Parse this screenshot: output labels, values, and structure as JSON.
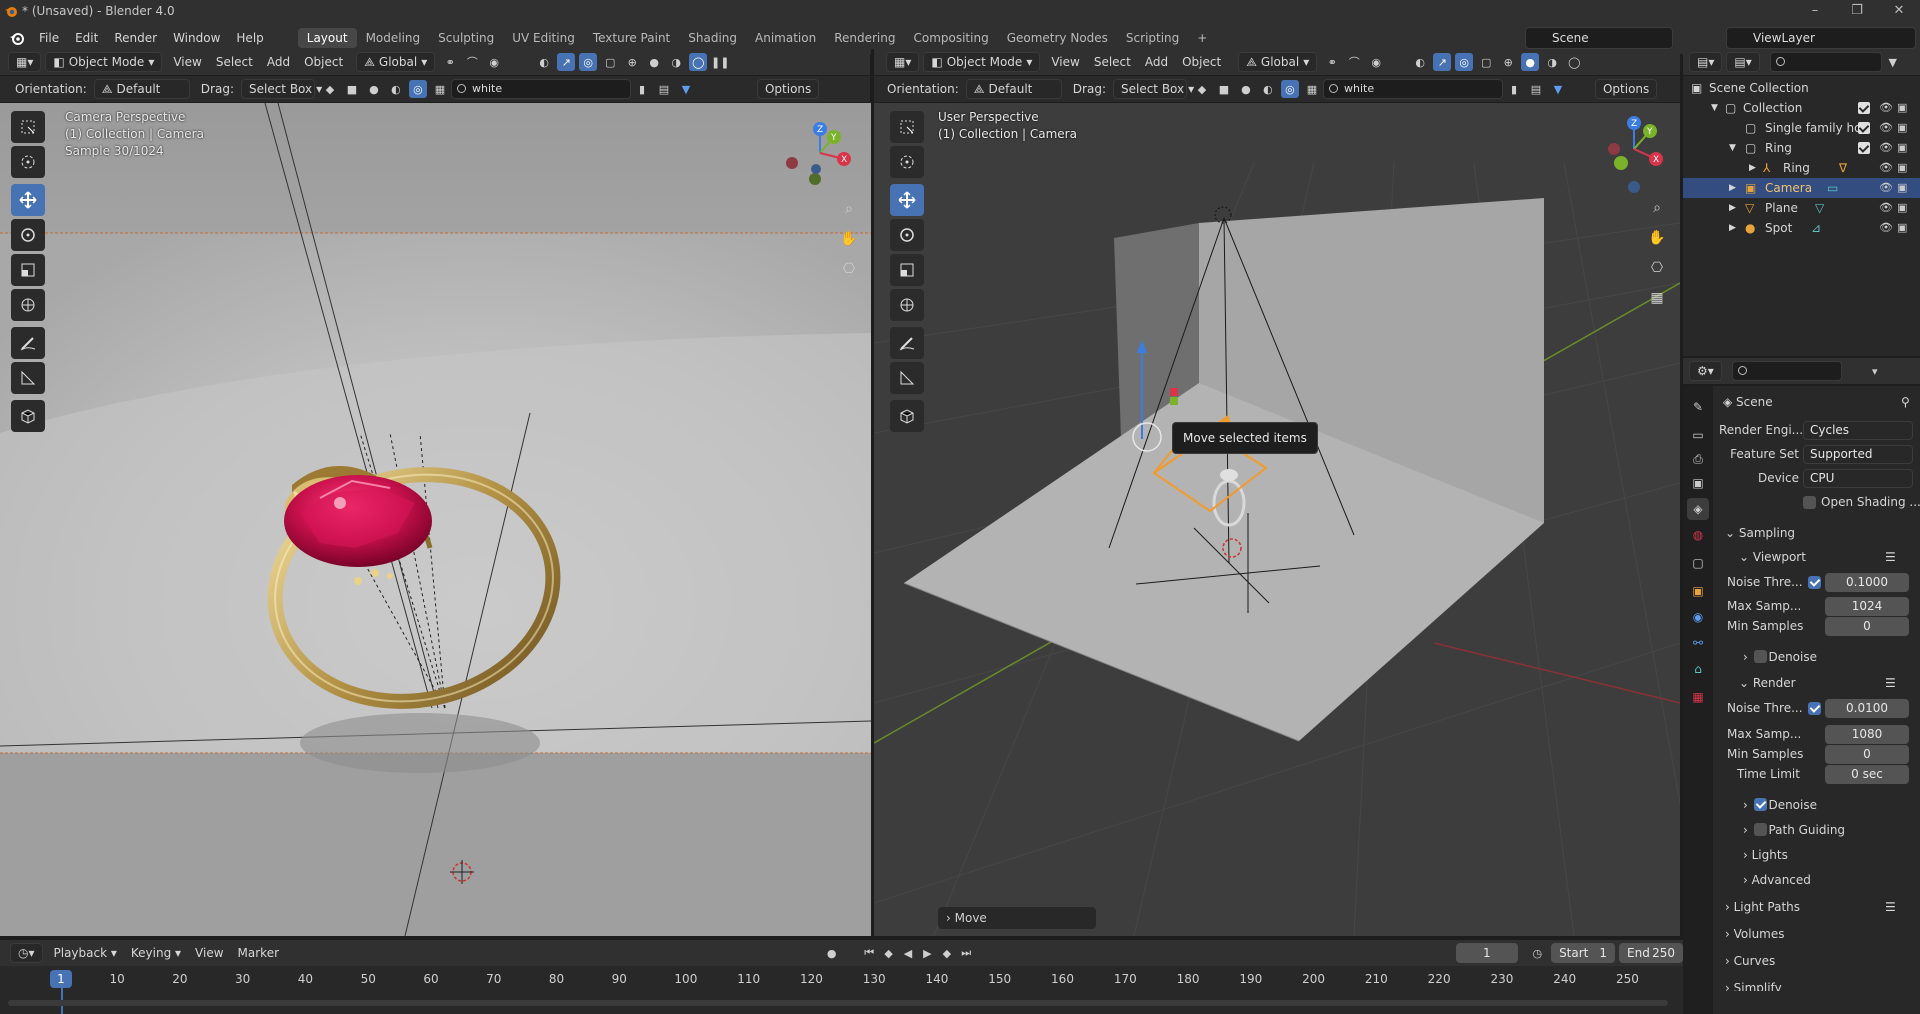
{
  "window": {
    "title": "* (Unsaved) - Blender 4.0",
    "minimize": "–",
    "maximize": "❐",
    "close": "✕"
  },
  "menu": [
    "File",
    "Edit",
    "Render",
    "Window",
    "Help"
  ],
  "workspaces": [
    "Layout",
    "Modeling",
    "Sculpting",
    "UV Editing",
    "Texture Paint",
    "Shading",
    "Animation",
    "Rendering",
    "Compositing",
    "Geometry Nodes",
    "Scripting",
    "+"
  ],
  "scene": "Scene",
  "view_layer": "ViewLayer",
  "left_view": {
    "mode": "Object Mode",
    "menus": [
      "View",
      "Select",
      "Add",
      "Object"
    ],
    "transform": "Global",
    "orientation_label": "Orientation:",
    "orientation": "Default",
    "drag_label": "Drag:",
    "drag": "Select Box",
    "search_value": "white",
    "options": "Options",
    "overlay": [
      "Camera Perspective",
      "(1) Collection | Camera",
      "Sample 30/1024"
    ]
  },
  "right_view": {
    "mode": "Object Mode",
    "menus": [
      "View",
      "Select",
      "Add",
      "Object"
    ],
    "transform": "Global",
    "orientation_label": "Orientation:",
    "orientation": "Default",
    "drag_label": "Drag:",
    "drag": "Select Box",
    "search_value": "white",
    "options": "Options",
    "overlay": [
      "User Perspective",
      "(1) Collection | Camera"
    ],
    "tooltip": "Move selected items",
    "last_op": "Move"
  },
  "outliner": {
    "rows": [
      {
        "label": "Scene Collection"
      },
      {
        "label": "Collection"
      },
      {
        "label": "Single family ho"
      },
      {
        "label": "Ring"
      },
      {
        "label": "Ring"
      },
      {
        "label": "Camera"
      },
      {
        "label": "Plane"
      },
      {
        "label": "Spot"
      }
    ]
  },
  "props": {
    "context": "Scene",
    "render_engine_label": "Render Engi...",
    "render_engine": "Cycles",
    "feature_set_label": "Feature Set",
    "feature_set": "Supported",
    "device_label": "Device",
    "device": "CPU",
    "osl_label": "Open Shading ...",
    "sampling": "Sampling",
    "viewport": "Viewport",
    "vp_noise_label": "Noise Thre...",
    "vp_noise": "0.1000",
    "vp_max_label": "Max Samp...",
    "vp_max": "1024",
    "vp_min_label": "Min Samples",
    "vp_min": "0",
    "denoise": "Denoise",
    "render": "Render",
    "r_noise_label": "Noise Thre...",
    "r_noise": "0.0100",
    "r_max_label": "Max Samp...",
    "r_max": "1080",
    "r_min_label": "Min Samples",
    "r_min": "0",
    "time_limit_label": "Time Limit",
    "time_limit": "0 sec",
    "r_denoise": "Denoise",
    "path_guiding": "Path Guiding",
    "lights": "Lights",
    "advanced": "Advanced",
    "light_paths": "Light Paths",
    "volumes": "Volumes",
    "curves": "Curves",
    "simplify": "Simplify"
  },
  "timeline": {
    "menus": [
      "Playback",
      "Keying",
      "View",
      "Marker"
    ],
    "current_frame": "1",
    "start_label": "Start",
    "start": "1",
    "end_label": "End",
    "end": "250",
    "ticks": [
      "1",
      "10",
      "20",
      "30",
      "40",
      "50",
      "60",
      "70",
      "80",
      "90",
      "100",
      "110",
      "120",
      "130",
      "140",
      "150",
      "160",
      "170",
      "180",
      "190",
      "200",
      "210",
      "220",
      "230",
      "240",
      "250"
    ]
  }
}
